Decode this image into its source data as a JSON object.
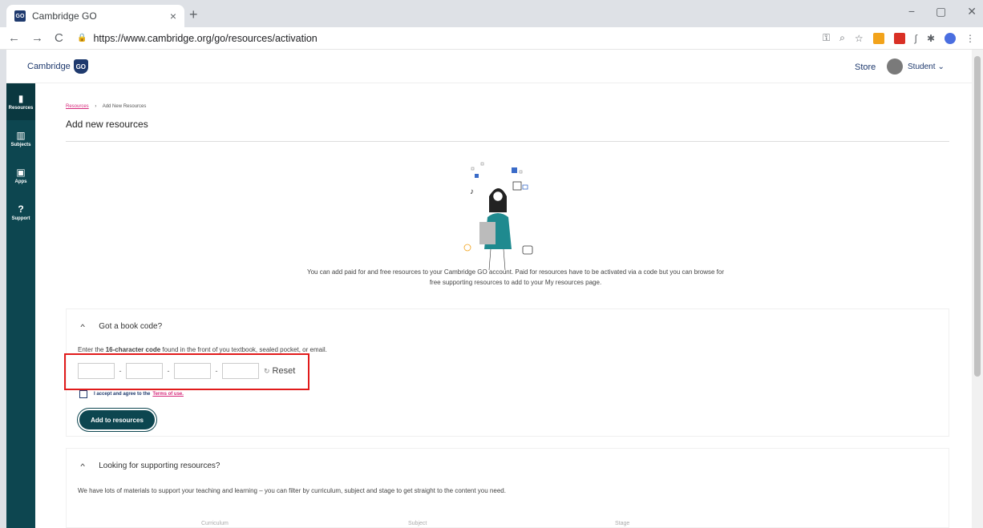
{
  "browser": {
    "tab_title": "Cambridge GO",
    "tab_favicon": "GO",
    "tab_close": "×",
    "new_tab": "+",
    "url": "https://www.cambridge.org/go/resources/activation",
    "window_controls": [
      "−",
      "▢",
      "✕"
    ]
  },
  "header": {
    "logo_text": "Cambridge",
    "logo_badge": "GO",
    "store": "Store",
    "user": "Student"
  },
  "sidebar": {
    "items": [
      {
        "label": "Resources",
        "icon": "document-icon"
      },
      {
        "label": "Subjects",
        "icon": "books-icon"
      },
      {
        "label": "Apps",
        "icon": "apps-grid-icon"
      },
      {
        "label": "Support",
        "icon": "question-icon"
      }
    ]
  },
  "breadcrumb": {
    "link": "Resources",
    "separator": "›",
    "current": "Add New Resources"
  },
  "page_title": "Add new resources",
  "intro_line1": "You can add paid for and free resources to your Cambridge GO account. Paid for resources have to be activated via a code but you can browse for",
  "intro_line2": "free supporting resources to add to your My resources page.",
  "book_code": {
    "heading": "Got a book code?",
    "desc_before": "Enter the ",
    "desc_bold": "16-character code",
    "desc_after": " found in the front of you textbook, sealed pocket, or email.",
    "separator": "-",
    "reset": "Reset",
    "accept_text": "I accept and agree to the",
    "terms_link": "Terms of use.",
    "add_button": "Add to resources"
  },
  "supporting": {
    "heading": "Looking for supporting resources?",
    "desc": "We have lots of materials to support your teaching and learning – you can filter by curriculum, subject and stage to get straight to the content you need.",
    "filters": [
      "Curriculum",
      "Subject",
      "Stage"
    ]
  },
  "colors": {
    "sidebar": "#0d4650",
    "brand": "#1f3a6e",
    "link": "#d6287a",
    "highlight": "#e11b1b"
  }
}
